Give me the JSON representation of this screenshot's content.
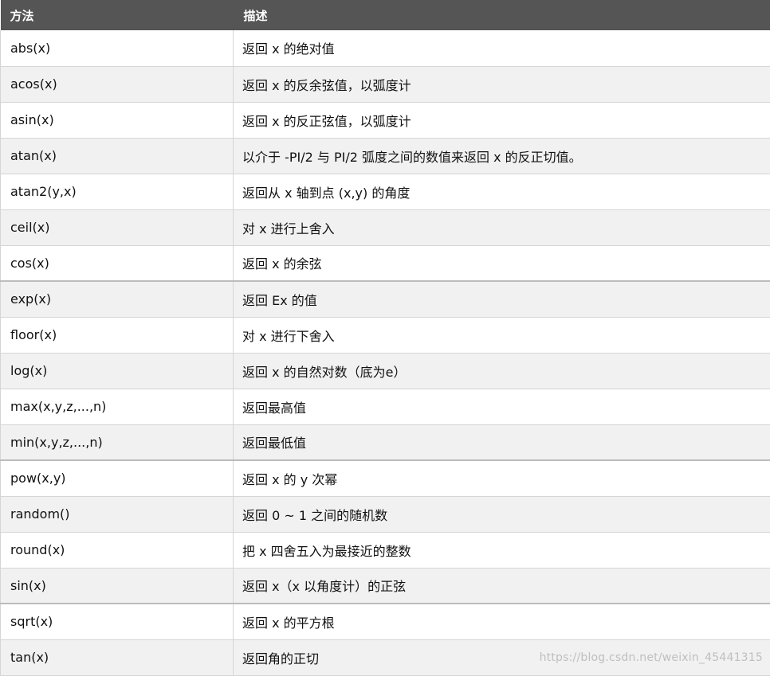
{
  "header": {
    "method": "方法",
    "description": "描述"
  },
  "rows": [
    {
      "method": "abs(x)",
      "description": "返回 x 的绝对值"
    },
    {
      "method": "acos(x)",
      "description": "返回 x 的反余弦值，以弧度计"
    },
    {
      "method": "asin(x)",
      "description": "返回 x 的反正弦值，以弧度计"
    },
    {
      "method": "atan(x)",
      "description": "以介于 -PI/2 与 PI/2 弧度之间的数值来返回 x 的反正切值。"
    },
    {
      "method": "atan2(y,x)",
      "description": "返回从 x 轴到点 (x,y) 的角度"
    },
    {
      "method": "ceil(x)",
      "description": "对 x 进行上舍入"
    },
    {
      "method": "cos(x)",
      "description": "返回 x 的余弦"
    },
    {
      "method": "exp(x)",
      "description": "返回 Ex 的值"
    },
    {
      "method": "floor(x)",
      "description": "对 x 进行下舍入"
    },
    {
      "method": "log(x)",
      "description": "返回 x 的自然对数（底为e）"
    },
    {
      "method": "max(x,y,z,...,n)",
      "description": "返回最高值"
    },
    {
      "method": "min(x,y,z,...,n)",
      "description": "返回最低值"
    },
    {
      "method": "pow(x,y)",
      "description": "返回 x 的 y 次幂"
    },
    {
      "method": "random()",
      "description": "返回 0 ~ 1 之间的随机数"
    },
    {
      "method": "round(x)",
      "description": "把 x 四舍五入为最接近的整数"
    },
    {
      "method": "sin(x)",
      "description": "返回 x（x 以角度计）的正弦"
    },
    {
      "method": "sqrt(x)",
      "description": "返回 x 的平方根"
    },
    {
      "method": "tan(x)",
      "description": "返回角的正切"
    }
  ],
  "watermark": "https://blog.csdn.net/weixin_45441315"
}
